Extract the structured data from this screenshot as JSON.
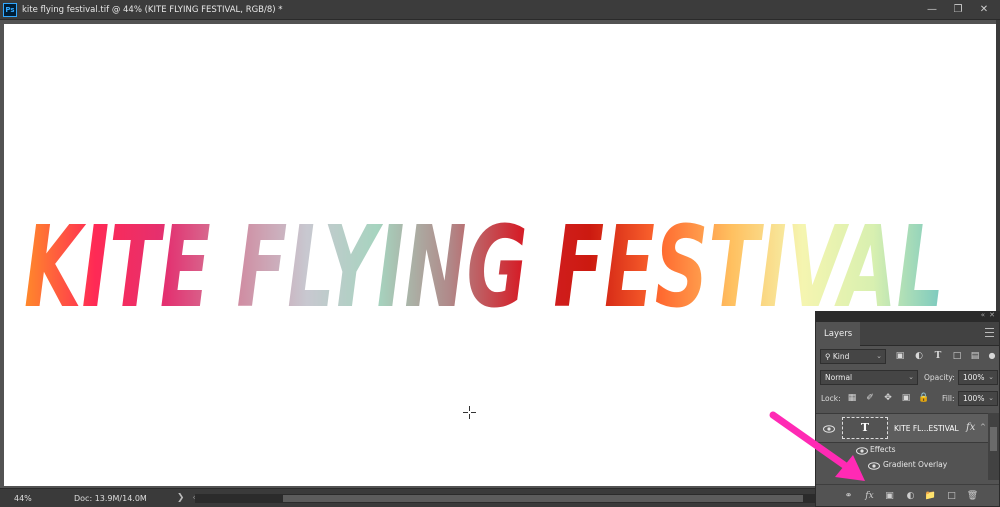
{
  "window": {
    "doc_title": "kite flying festival.tif @ 44% (KITE FLYING FESTIVAL, RGB/8) *",
    "app_icon": "Ps",
    "minimize": "—",
    "restore": "❐",
    "close": "✕"
  },
  "canvas": {
    "text": "KITE FLYING FESTIVAL",
    "gradient_colors": [
      "#ff8a2a",
      "#ff2a55",
      "#e33070",
      "#d08aa0",
      "#c8c8d0",
      "#a6d4bf",
      "#b08a8a",
      "#d4202a",
      "#cc1a10",
      "#ff6a30",
      "#ffc060",
      "#f5f5b0",
      "#d8f0b0",
      "#78c8c0"
    ]
  },
  "status": {
    "zoom": "44%",
    "doc_size": "Doc: 13.9M/14.0M",
    "arrow": "❯",
    "scroll_left": "‹"
  },
  "layers_panel": {
    "collapse": "«",
    "close": "✕",
    "tab": "Layers",
    "filter_kind": "Kind",
    "blend_mode": "Normal",
    "opacity_label": "Opacity:",
    "opacity_value": "100%",
    "lock_label": "Lock:",
    "fill_label": "Fill:",
    "fill_value": "100%",
    "layer": {
      "thumb_glyph": "T",
      "name": "KITE FL...ESTIVAL",
      "fx": "fx",
      "caret": "^"
    },
    "effects_label": "Effects",
    "effect_item": "Gradient Overlay",
    "bottom_fx": "fx"
  },
  "annotation_color": "#ff2ab4"
}
